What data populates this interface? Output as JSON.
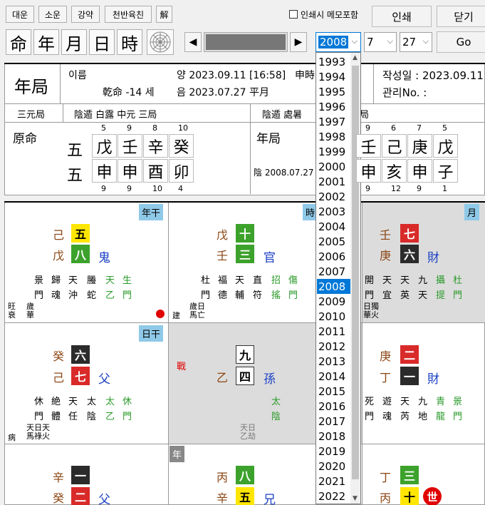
{
  "toolbar": {
    "btn1": "대운",
    "btn2": "소운",
    "btn3": "강약",
    "btn4": "천반육친",
    "btn5": "解",
    "memo_checkbox": "인쇄시 메모포함",
    "print": "인쇄",
    "close": "닫기",
    "go": "Go",
    "pillars": [
      "命",
      "年",
      "月",
      "日",
      "時"
    ],
    "year_value": "2008",
    "month_value": "7",
    "day_value": "27"
  },
  "header": {
    "title": "年局",
    "name_label": "이름",
    "yang_date": "양 2023.09.11 [16:58]",
    "shichen": "申時",
    "gender_age": "乾命 -14 세",
    "yin_date": "음 2023.07.27 平月",
    "write_date": "작성일 : 2023.09.11",
    "manage_no": "관리No. :"
  },
  "row2": {
    "a": "三元局",
    "b": "陰遁 白露 中元 三局",
    "c": "陰遁 處暑",
    "d": "局"
  },
  "origin": {
    "label": "原命",
    "left_top": "五",
    "left_bottom": "五",
    "top_nums": [
      "5",
      "9",
      "8",
      "10"
    ],
    "stems": [
      "戊",
      "壬",
      "辛",
      "癸"
    ],
    "branches": [
      "申",
      "申",
      "酉",
      "卯"
    ],
    "bottom_nums": [
      "9",
      "9",
      "10",
      "4"
    ]
  },
  "yearju": {
    "label": "年局",
    "date": "陰 2008.07.27",
    "top_nums": [
      "9",
      "6",
      "7",
      "5"
    ],
    "stems": [
      "壬",
      "己",
      "庚",
      "戊"
    ],
    "branches": [
      "申",
      "亥",
      "申",
      "子"
    ],
    "bottom_nums": [
      "9",
      "12",
      "9",
      "1"
    ]
  },
  "palaces": {
    "p1": {
      "tag": "年干",
      "s1": "己",
      "s2": "戊",
      "t1": "五",
      "t2": "八",
      "rel": "鬼",
      "g1": [
        "景",
        "門"
      ],
      "g2": [
        "歸",
        "魂"
      ],
      "g3": [
        "天",
        "沖"
      ],
      "g4": [
        "螣",
        "蛇"
      ],
      "g5": [
        "天",
        "乙"
      ],
      "g6": [
        "生",
        "門"
      ],
      "b1": "旺",
      "b2": "衰",
      "b3": "歲",
      "b4": "華"
    },
    "p2": {
      "tag": "時",
      "s1": "戊",
      "s2": "壬",
      "t1": "十",
      "t2": "三",
      "rel": "官",
      "g1": [
        "杜",
        "門"
      ],
      "g2": [
        "福",
        "德"
      ],
      "g3": [
        "天",
        "輔"
      ],
      "g4": [
        "直",
        "符"
      ],
      "g5": [
        "招",
        "搖"
      ],
      "g6": [
        "傷",
        "門"
      ],
      "b1": "建",
      "b2": "歲日",
      "b3": "馬亡"
    },
    "p3": {
      "tag": "月",
      "s1": "壬",
      "s2": "庚",
      "t1": "七",
      "t2": "六",
      "rel": "財",
      "g1": [
        "開",
        "門"
      ],
      "g2": [
        "天",
        "宜"
      ],
      "g3": [
        "天",
        "英"
      ],
      "g4": [
        "九",
        "天"
      ],
      "g5": [
        "攝",
        "提"
      ],
      "g6": [
        "杜",
        "門"
      ],
      "b1": "日獨",
      "b2": "華火"
    },
    "p4": {
      "tag": "日干",
      "s1": "癸",
      "s2": "己",
      "t1": "六",
      "t2": "七",
      "rel": "父",
      "g1": [
        "休",
        "門"
      ],
      "g2": [
        "絶",
        "體"
      ],
      "g3": [
        "天",
        "任"
      ],
      "g4": [
        "太",
        "陰"
      ],
      "g5": [
        "太",
        "乙"
      ],
      "g6": [
        "休",
        "門"
      ],
      "b1": "病",
      "b2": "天日天",
      "b3": "馬祿火"
    },
    "p5": {
      "war": "戰",
      "s1": "乙",
      "t1": "九",
      "t2": "四",
      "rel": "孫",
      "g1": [
        "太",
        "陰"
      ],
      "b1": "天日",
      "b2": "乙劫"
    },
    "p6": {
      "s1": "庚",
      "s2": "丁",
      "t1": "二",
      "t2": "一",
      "rel": "財",
      "g1": [
        "死",
        "門"
      ],
      "g2": [
        "遊",
        "魂"
      ],
      "g3": [
        "天",
        "芮"
      ],
      "g4": [
        "九",
        "地"
      ],
      "g5": [
        "青",
        "龍"
      ],
      "g6": [
        "景",
        "門"
      ]
    },
    "p7": {
      "s1": "辛",
      "s2": "癸",
      "t1": "一",
      "t2": "二",
      "rel": "父"
    },
    "p8": {
      "tag": "年",
      "s1": "丙",
      "s2": "辛",
      "t1": "八",
      "t2": "五",
      "rel": "兄"
    },
    "p9": {
      "s1": "丁",
      "s2": "丙",
      "t1": "三",
      "t2": "十",
      "world": "世"
    }
  },
  "year_options": [
    "1993",
    "1994",
    "1995",
    "1996",
    "1997",
    "1998",
    "1999",
    "2000",
    "2001",
    "2002",
    "2003",
    "2004",
    "2005",
    "2006",
    "2007",
    "2008",
    "2009",
    "2010",
    "2011",
    "2012",
    "2013",
    "2014",
    "2015",
    "2016",
    "2017",
    "2018",
    "2019",
    "2020",
    "2021",
    "2022"
  ],
  "year_selected": "2008",
  "colors": {
    "accent": "#0078d7",
    "tag_blue": "#8fc9e8",
    "red_dot": "#e00000"
  }
}
